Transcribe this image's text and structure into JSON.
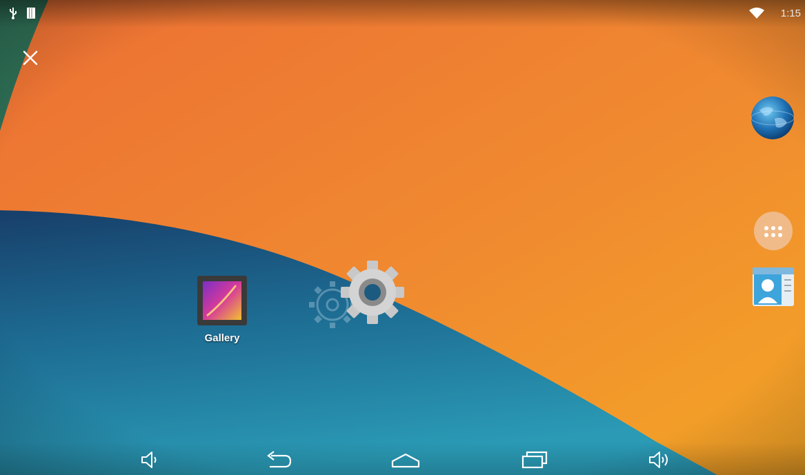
{
  "status_bar": {
    "time": "1:15",
    "icons": [
      "usb-icon",
      "battery-icon",
      "wifi-icon"
    ]
  },
  "home": {
    "close_icon": "close-icon",
    "apps": [
      {
        "label": "Gallery",
        "icon": "gallery-icon"
      }
    ],
    "dragging_icon": "settings-gear-icon"
  },
  "dock": {
    "items": [
      "browser-globe-icon",
      "all-apps-icon",
      "contacts-icon"
    ]
  },
  "nav_bar": {
    "buttons": [
      "volume-down-icon",
      "back-icon",
      "home-icon",
      "recents-icon",
      "volume-up-icon"
    ]
  },
  "colors": {
    "orange": "#e9752f",
    "orange_light": "#f5a623",
    "teal": "#2a8aa6",
    "navy": "#1c4f78",
    "green": "#2e6e55"
  }
}
